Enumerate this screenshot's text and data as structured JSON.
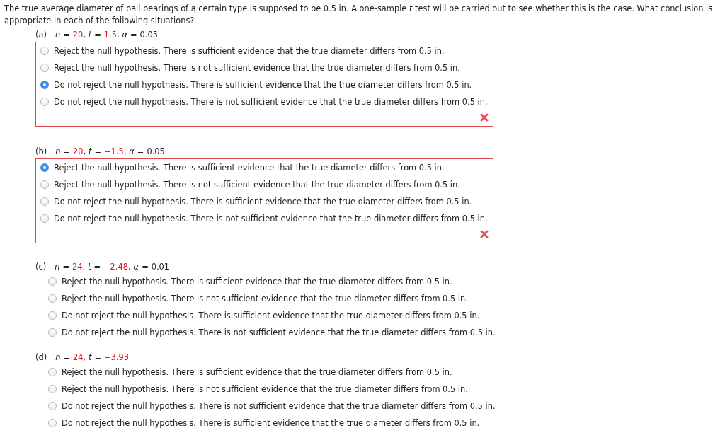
{
  "intro": "The true average diameter of ball bearings of a certain type is supposed to be 0.5 in. A one-sample *t* test will be carried out to see whether this is the case. What conclusion is appropriate in each of the following situations?",
  "parts": [
    {
      "label": "(a)",
      "marked_incorrect": true,
      "params": [
        {
          "symbol": "n",
          "relation": "=",
          "value": "20",
          "given": true,
          "after": ","
        },
        {
          "symbol": "t",
          "relation": "=",
          "value": "1.5",
          "given": true,
          "after": ","
        },
        {
          "symbol": "α",
          "relation": "=",
          "value": "0.05",
          "given": false
        }
      ],
      "options": [
        {
          "text": "Reject the null hypothesis. There is sufficient evidence that the true diameter differs from 0.5 in.",
          "selected": false
        },
        {
          "text": "Reject the null hypothesis. There is not sufficient evidence that the true diameter differs from 0.5 in.",
          "selected": false
        },
        {
          "text": "Do not reject the null hypothesis. There is sufficient evidence that the true diameter differs from 0.5 in.",
          "selected": true
        },
        {
          "text": "Do not reject the null hypothesis. There is not sufficient evidence that the true diameter differs from 0.5 in.",
          "selected": false
        }
      ]
    },
    {
      "label": "(b)",
      "marked_incorrect": true,
      "params": [
        {
          "symbol": "n",
          "relation": "=",
          "value": "20",
          "given": true,
          "after": ","
        },
        {
          "symbol": "t",
          "relation": "=",
          "value": "−1.5",
          "given": true,
          "after": ","
        },
        {
          "symbol": "α",
          "relation": "=",
          "value": "0.05",
          "given": false
        }
      ],
      "options": [
        {
          "text": "Reject the null hypothesis. There is sufficient evidence that the true diameter differs from 0.5 in.",
          "selected": true
        },
        {
          "text": "Reject the null hypothesis. There is not sufficient evidence that the true diameter differs from 0.5 in.",
          "selected": false
        },
        {
          "text": "Do not reject the null hypothesis. There is sufficient evidence that the true diameter differs from 0.5 in.",
          "selected": false
        },
        {
          "text": "Do not reject the null hypothesis. There is not sufficient evidence that the true diameter differs from 0.5 in.",
          "selected": false
        }
      ]
    },
    {
      "label": "(c)",
      "marked_incorrect": false,
      "params": [
        {
          "symbol": "n",
          "relation": "=",
          "value": "24",
          "given": true,
          "after": ","
        },
        {
          "symbol": "t",
          "relation": "=",
          "value": "−2.48",
          "given": true,
          "after": ","
        },
        {
          "symbol": "α",
          "relation": "=",
          "value": "0.01",
          "given": false
        }
      ],
      "options": [
        {
          "text": "Reject the null hypothesis. There is sufficient evidence that the true diameter differs from 0.5 in.",
          "selected": false
        },
        {
          "text": "Reject the null hypothesis. There is not sufficient evidence that the true diameter differs from 0.5 in.",
          "selected": false
        },
        {
          "text": "Do not reject the null hypothesis. There is sufficient evidence that the true diameter differs from 0.5 in.",
          "selected": false
        },
        {
          "text": "Do not reject the null hypothesis. There is not sufficient evidence that the true diameter differs from 0.5 in.",
          "selected": false
        }
      ]
    },
    {
      "label": "(d)",
      "marked_incorrect": false,
      "params": [
        {
          "symbol": "n",
          "relation": "=",
          "value": "24",
          "given": true,
          "after": ","
        },
        {
          "symbol": "t",
          "relation": "=",
          "value": "−3.93",
          "given": true
        }
      ],
      "options": [
        {
          "text": "Reject the null hypothesis. There is sufficient evidence that the true diameter differs from 0.5 in.",
          "selected": false
        },
        {
          "text": "Reject the null hypothesis. There is not sufficient evidence that the true diameter differs from 0.5 in.",
          "selected": false
        },
        {
          "text": "Do not reject the null hypothesis. There is not sufficient evidence that the true diameter differs from 0.5 in.",
          "selected": false
        },
        {
          "text": "Do not reject the null hypothesis. There is sufficient evidence that the true diameter differs from 0.5 in.",
          "selected": false
        }
      ]
    }
  ]
}
